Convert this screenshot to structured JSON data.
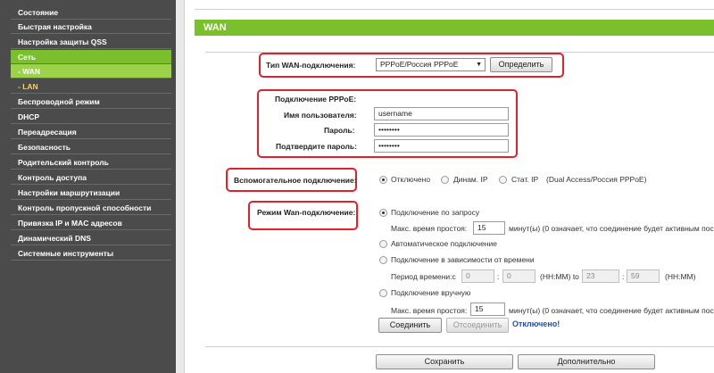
{
  "sidebar": {
    "items": [
      {
        "label": "Состояние"
      },
      {
        "label": "Быстрая настройка"
      },
      {
        "label": "Настройка защиты QSS"
      },
      {
        "label": "Сеть"
      },
      {
        "label": "- WAN"
      },
      {
        "label": "- LAN"
      },
      {
        "label": "Беспроводной режим"
      },
      {
        "label": "DHCP"
      },
      {
        "label": "Переадресация"
      },
      {
        "label": "Безопасность"
      },
      {
        "label": "Родительский контроль"
      },
      {
        "label": "Контроль доступа"
      },
      {
        "label": "Настройки маршрутизации"
      },
      {
        "label": "Контроль пропускной способности"
      },
      {
        "label": "Привязка IP и MAC адресов"
      },
      {
        "label": "Динамический DNS"
      },
      {
        "label": "Системные инструменты"
      }
    ]
  },
  "header": {
    "title": "WAN"
  },
  "wan_type": {
    "label": "Тип WAN-подключения:",
    "selected": "PPPoE/Россия PPPoE",
    "detect_button": "Определить"
  },
  "pppoe": {
    "section_label": "Подключение PPPoE:",
    "username_label": "Имя пользователя:",
    "username_value": "username",
    "password_label": "Пароль:",
    "password_value": "••••••••",
    "confirm_label": "Подтвердите пароль:",
    "confirm_value": "••••••••"
  },
  "secondary": {
    "label": "Вспомогательное подключение:",
    "opt_disabled": "Отключено",
    "opt_dynamic": "Динам. IP",
    "opt_static": "Стат. IP",
    "note": "(Dual Access/Россия PPPoE)"
  },
  "wan_mode": {
    "label": "Режим Wan-подключение:",
    "on_demand": "Подключение по запросу",
    "idle_label_1": "Макс. время простоя:",
    "idle_value_1": "15",
    "idle_note_1": "минут(ы) (0 означает, что соединение будет активным пос",
    "auto": "Автоматическое подключение",
    "time_based": "Подключение в зависимости от времени",
    "period_label": "Период времени:с",
    "period_from_h": "0",
    "period_from_m": "0",
    "period_from_fmt": "(HH:MM) to",
    "period_to_h": "23",
    "period_to_m": "59",
    "period_to_fmt": "(HH:MM)",
    "manual": "Подключение вручную",
    "idle_label_2": "Макс. время простоя:",
    "idle_value_2": "15",
    "idle_note_2": "минут(ы) (0 означает, что соединение будет активным пос",
    "connect_button": "Соединить",
    "disconnect_button": "Отсоединить",
    "status": "Отключено!"
  },
  "footer": {
    "save_button": "Сохранить",
    "advanced_button": "Дополнительно"
  },
  "colors": {
    "accent": "#7abf2c",
    "highlight": "#e0202a",
    "status": "#1d4fc2"
  }
}
